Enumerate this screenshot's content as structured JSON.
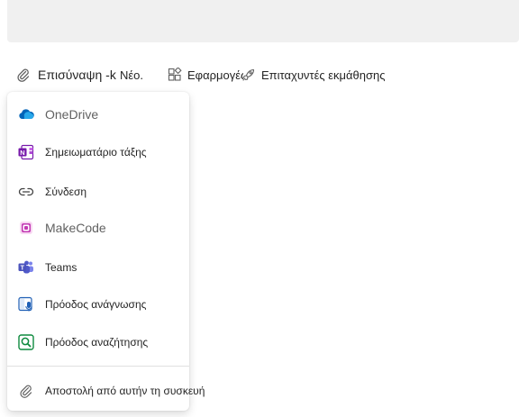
{
  "toolbar": {
    "attach_label": "Επισύναψη -k",
    "new_label": "Νέο.",
    "apps_label": "Εφαρμογές",
    "accelerators_label": "Επιταχυντές εκμάθησης"
  },
  "attach_menu": {
    "items": [
      {
        "label": "OneDrive",
        "icon": "onedrive-icon"
      },
      {
        "label": "Σημειωματάριο τάξης",
        "icon": "onenote-icon"
      },
      {
        "label": "Σύνδεση",
        "icon": "link-icon"
      },
      {
        "label": "MakeCode",
        "icon": "makecode-icon"
      },
      {
        "label": "Teams",
        "icon": "teams-icon"
      },
      {
        "label": "Πρόοδος ανάγνωσης",
        "icon": "reading-progress-icon"
      },
      {
        "label": "Πρόοδος αναζήτησης",
        "icon": "search-progress-icon"
      },
      {
        "label": "Αποστολή από αυτήν τη συσκευή",
        "icon": "paperclip-icon"
      }
    ]
  },
  "colors": {
    "input_bg": "#f0f0f0",
    "onedrive_blue": "#0364b8",
    "onenote_purple": "#7719aa",
    "makecode_magenta": "#c239b3",
    "teams_indigo": "#5059c9",
    "reading_blue": "#1f5fb5",
    "search_green": "#0e8a3e"
  }
}
